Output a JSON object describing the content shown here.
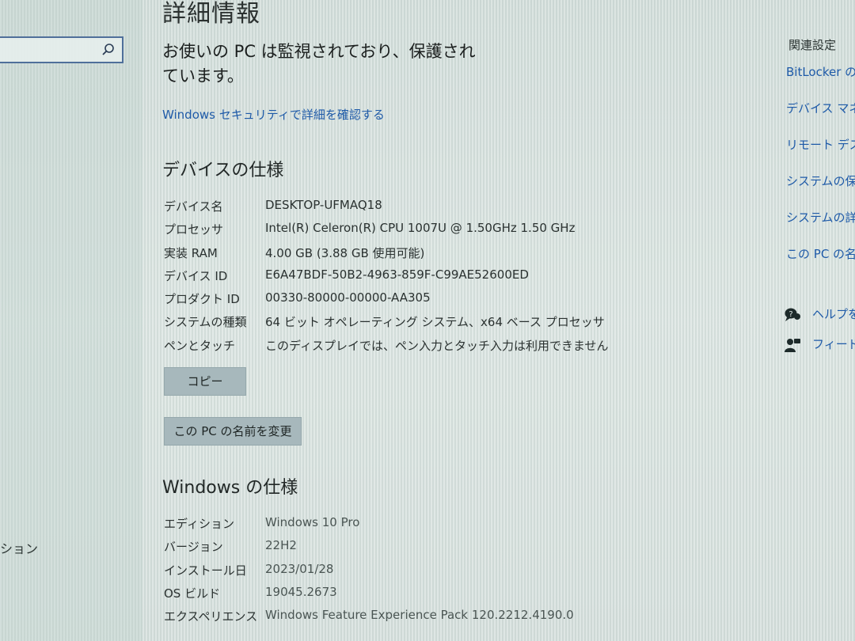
{
  "left_pane": {
    "search_placeholder": "",
    "partial_item": "ション"
  },
  "page": {
    "title": "詳細情報",
    "security_message": "お使いの PC は監視されており、保護されています。",
    "security_link": "Windows セキュリティで詳細を確認する"
  },
  "device_specs": {
    "heading": "デバイスの仕様",
    "rows": [
      {
        "key": "デバイス名",
        "value": "DESKTOP-UFMAQ18"
      },
      {
        "key": "プロセッサ",
        "value": "Intel(R) Celeron(R) CPU 1007U @ 1.50GHz   1.50 GHz"
      },
      {
        "key": "実装 RAM",
        "value": "4.00 GB (3.88 GB 使用可能)"
      },
      {
        "key": "デバイス ID",
        "value": "E6A47BDF-50B2-4963-859F-C99AE52600ED"
      },
      {
        "key": "プロダクト ID",
        "value": "00330-80000-00000-AA305"
      },
      {
        "key": "システムの種類",
        "value": "64 ビット オペレーティング システム、x64 ベース プロセッサ"
      },
      {
        "key": "ペンとタッチ",
        "value": "このディスプレイでは、ペン入力とタッチ入力は利用できません"
      }
    ],
    "copy_button": "コピー",
    "rename_button": "この PC の名前を変更"
  },
  "windows_specs": {
    "heading": "Windows の仕様",
    "rows": [
      {
        "key": "エディション",
        "value": "Windows 10 Pro"
      },
      {
        "key": "バージョン",
        "value": "22H2"
      },
      {
        "key": "インストール日",
        "value": "2023/01/28"
      },
      {
        "key": "OS ビルド",
        "value": "19045.2673"
      },
      {
        "key": "エクスペリエンス",
        "value": "Windows Feature Experience Pack 120.2212.4190.0"
      }
    ]
  },
  "related": {
    "heading": "関連設定",
    "links": [
      "BitLocker の",
      "デバイス マネー",
      "リモート デスク",
      "システムの保護",
      "システムの詳細",
      "この PC の名前"
    ],
    "help": "ヘルプを",
    "feedback": "フィードバ"
  },
  "colors": {
    "link": "#1e5aa8",
    "button": "#a7b8bc"
  },
  "icons": {
    "search": "search-icon",
    "help": "help-icon",
    "feedback": "feedback-icon"
  }
}
